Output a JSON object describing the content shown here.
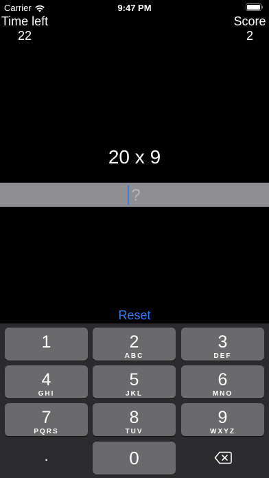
{
  "status_bar": {
    "carrier": "Carrier",
    "time": "9:47 PM"
  },
  "header": {
    "time_left_label": "Time left",
    "time_left_value": "22",
    "score_label": "Score",
    "score_value": "2"
  },
  "question": {
    "text": "20 x 9",
    "answer_placeholder": "?"
  },
  "reset_label": "Reset",
  "keypad": {
    "keys": [
      {
        "digit": "1",
        "letters": ""
      },
      {
        "digit": "2",
        "letters": "ABC"
      },
      {
        "digit": "3",
        "letters": "DEF"
      },
      {
        "digit": "4",
        "letters": "GHI"
      },
      {
        "digit": "5",
        "letters": "JKL"
      },
      {
        "digit": "6",
        "letters": "MNO"
      },
      {
        "digit": "7",
        "letters": "PQRS"
      },
      {
        "digit": "8",
        "letters": "TUV"
      },
      {
        "digit": "9",
        "letters": "WXYZ"
      }
    ],
    "dot_label": ".",
    "zero_label": "0",
    "delete_icon": "delete-backspace-icon"
  },
  "colors": {
    "accent": "#2f7cf6",
    "key": "#6a6a6d",
    "keypad_bg": "#2b2b2d",
    "answer_bar": "#8e8e93"
  }
}
